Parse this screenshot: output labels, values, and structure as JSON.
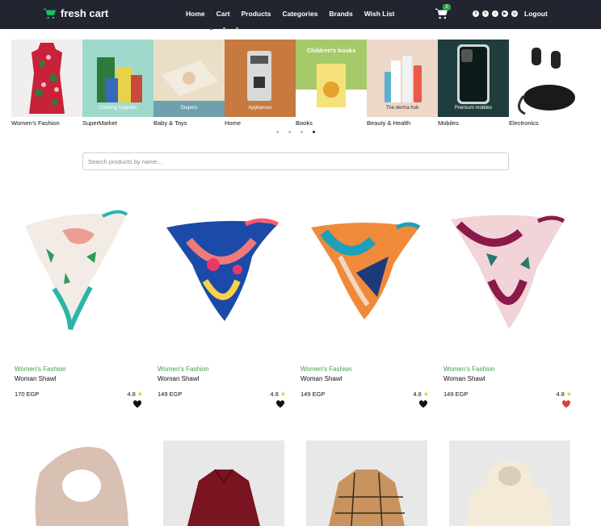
{
  "brand": {
    "name": "fresh cart",
    "icon": "shopping-cart-icon",
    "color": "#16c25b"
  },
  "nav": {
    "links": [
      "Home",
      "Cart",
      "Products",
      "Categories",
      "Brands",
      "Wish List"
    ]
  },
  "cart": {
    "count": "2",
    "icon": "cart-icon"
  },
  "socials": [
    "facebook-icon",
    "twitter-icon",
    "tiktok-icon",
    "youtube-icon",
    "instagram-icon"
  ],
  "logout_label": "Logout",
  "categories": [
    {
      "label": "Women's Fashion",
      "overlay": ""
    },
    {
      "label": "SuperMarket",
      "overlay": "Cooking Supplies"
    },
    {
      "label": "Baby & Toys",
      "overlay": "Diapers"
    },
    {
      "label": "Home",
      "overlay": "Appliances"
    },
    {
      "label": "Books",
      "overlay": "Children's books"
    },
    {
      "label": "Beauty & Health",
      "overlay": "The derma hub"
    },
    {
      "label": "Mobiles",
      "overlay": "Premium mobiles"
    },
    {
      "label": "Electronics",
      "overlay": ""
    }
  ],
  "search": {
    "placeholder": "Search products by name...",
    "value": ""
  },
  "products": [
    {
      "category": "Women's Fashion",
      "name": "Woman Shawl",
      "price": "170 EGP",
      "rating": "4.8",
      "wishlisted": false
    },
    {
      "category": "Women's Fashion",
      "name": "Woman Shawl",
      "price": "149 EGP",
      "rating": "4.8",
      "wishlisted": false
    },
    {
      "category": "Women's Fashion",
      "name": "Woman Shawl",
      "price": "149 EGP",
      "rating": "4.8",
      "wishlisted": false
    },
    {
      "category": "Women's Fashion",
      "name": "Woman Shawl",
      "price": "149 EGP",
      "rating": "4.8",
      "wishlisted": true
    }
  ],
  "colors": {
    "navbar": "#222530",
    "accent": "#3aa345",
    "heart_active": "#e03c3c",
    "star": "#f5c518"
  }
}
